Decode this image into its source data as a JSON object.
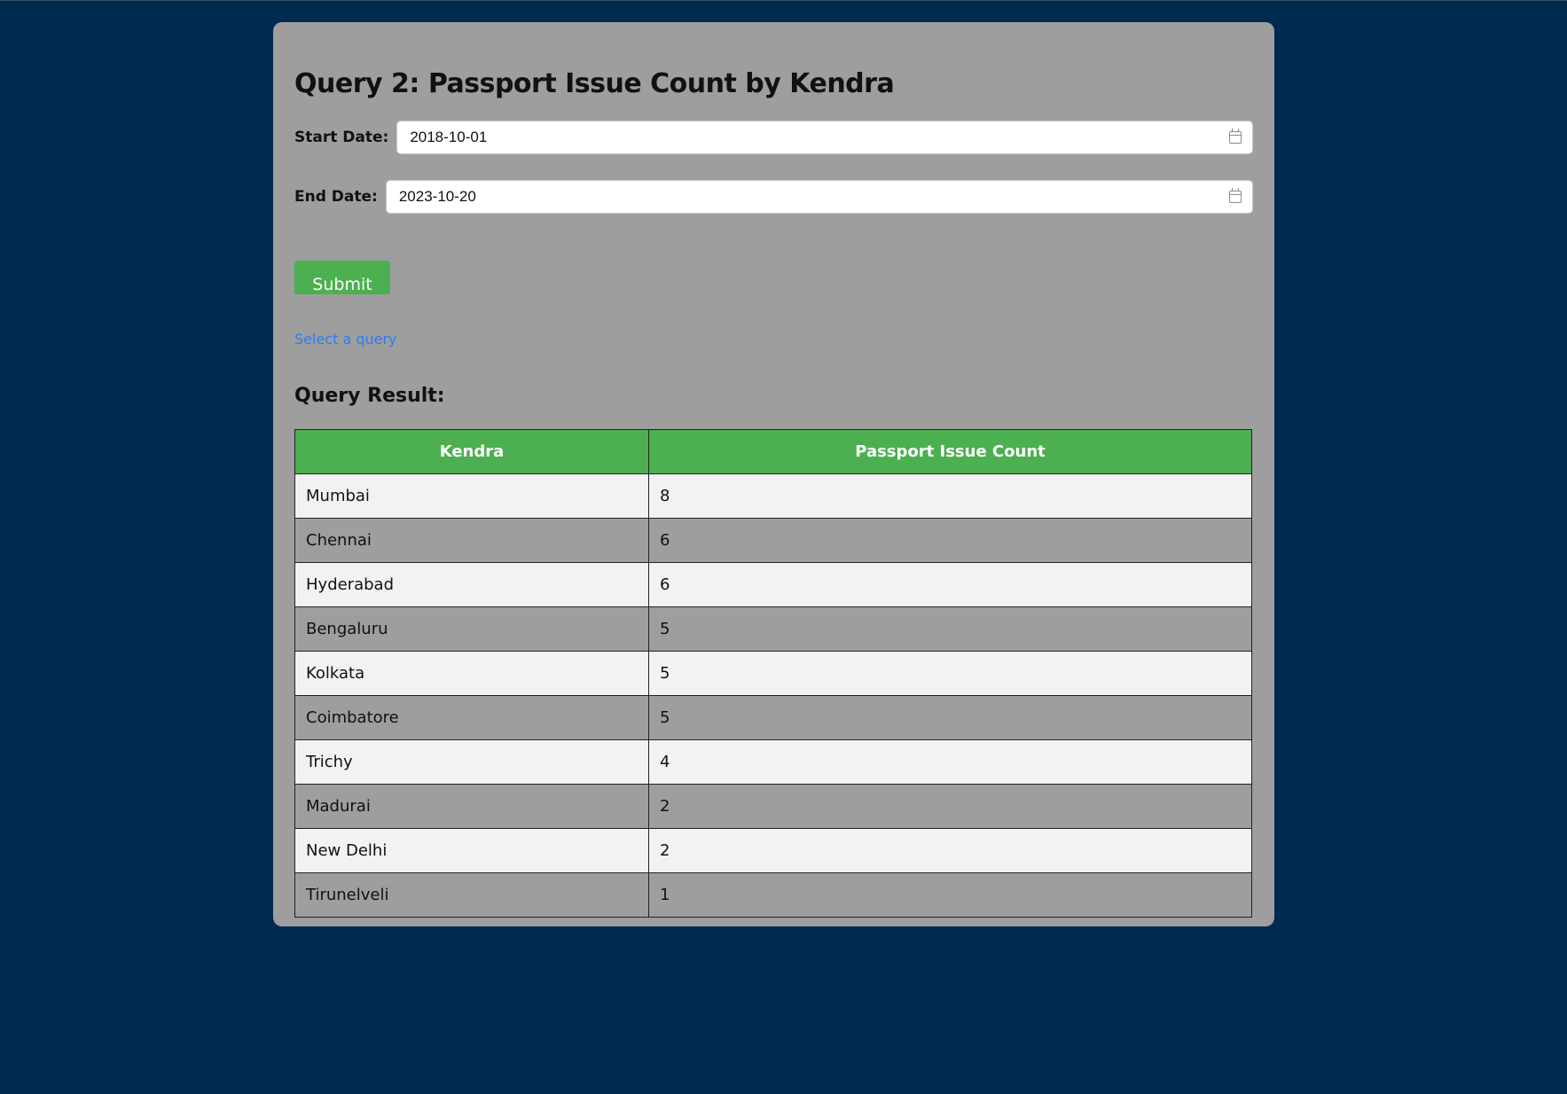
{
  "page": {
    "title": "Query 2: Passport Issue Count by Kendra"
  },
  "form": {
    "start_label": "Start Date:",
    "start_value": "2018-10-01",
    "end_label": "End Date:",
    "end_value": "2023-10-20",
    "submit_label": "Submit"
  },
  "links": {
    "select_query": "Select a query"
  },
  "result": {
    "heading": "Query Result:",
    "columns": [
      "Kendra",
      "Passport Issue Count"
    ],
    "rows": [
      [
        "Mumbai",
        "8"
      ],
      [
        "Chennai",
        "6"
      ],
      [
        "Hyderabad",
        "6"
      ],
      [
        "Bengaluru",
        "5"
      ],
      [
        "Kolkata",
        "5"
      ],
      [
        "Coimbatore",
        "5"
      ],
      [
        "Trichy",
        "4"
      ],
      [
        "Madurai",
        "2"
      ],
      [
        "New Delhi",
        "2"
      ],
      [
        "Tirunelveli",
        "1"
      ]
    ]
  },
  "colors": {
    "background": "#002a4f",
    "panel": "#9e9e9e",
    "accent_green": "#4caf50",
    "link_blue": "#2b7cf3",
    "row_light": "#f2f2f2",
    "row_dark": "#9e9e9e"
  },
  "icons": {
    "date_picker": "calendar-icon"
  }
}
